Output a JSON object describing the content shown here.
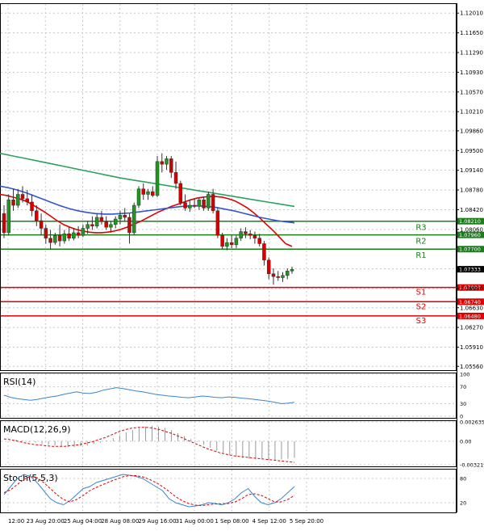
{
  "chart_data": {
    "type": "candlestick",
    "price_axis_ticks": [
      "1.12010",
      "1.11650",
      "1.11290",
      "1.10930",
      "1.10570",
      "1.10210",
      "1.09860",
      "1.09500",
      "1.09140",
      "1.08780",
      "1.08420",
      "1.08060",
      "1.07340",
      "1.06980",
      "1.06630",
      "1.06270",
      "1.05910",
      "1.05560"
    ],
    "price_range": [
      1.0549,
      1.1219
    ],
    "time_labels": [
      "12:00",
      "23 Aug 20:00",
      "25 Aug 04:00",
      "28 Aug 08:00",
      "29 Aug 16:00",
      "31 Aug 00:00",
      "1 Sep 08:00",
      "4 Sep 12:00",
      "5 Sep 20:00"
    ],
    "current_price": "1.07333",
    "levels": [
      {
        "label": "R3",
        "value": "1.08210",
        "price": 1.0821,
        "color": "#1a7f1a"
      },
      {
        "label": "R2",
        "value": "1.07960",
        "price": 1.0796,
        "color": "#1a7f1a"
      },
      {
        "label": "R1",
        "value": "1.07700",
        "price": 1.077,
        "color": "#1a7f1a"
      },
      {
        "label": "S1",
        "value": "1.07000",
        "price": 1.07,
        "color": "#e00000"
      },
      {
        "label": "S2",
        "value": "1.06740",
        "price": 1.0674,
        "color": "#e00000"
      },
      {
        "label": "S3",
        "value": "1.06480",
        "price": 1.0648,
        "color": "#e00000"
      }
    ],
    "candles": [
      [
        1.0835,
        1.085,
        1.079,
        1.08
      ],
      [
        1.08,
        1.087,
        1.0795,
        1.086
      ],
      [
        1.086,
        1.088,
        1.084,
        1.085
      ],
      [
        1.085,
        1.088,
        1.0845,
        1.087
      ],
      [
        1.087,
        1.0885,
        1.0855,
        1.0862
      ],
      [
        1.0862,
        1.0878,
        1.085,
        1.0856
      ],
      [
        1.0856,
        1.087,
        1.083,
        1.084
      ],
      [
        1.084,
        1.085,
        1.0812,
        1.0822
      ],
      [
        1.0822,
        1.0835,
        1.0795,
        1.0808
      ],
      [
        1.0808,
        1.0815,
        1.078,
        1.079
      ],
      [
        1.079,
        1.0805,
        1.077,
        1.0782
      ],
      [
        1.0782,
        1.08,
        1.0778,
        1.0795
      ],
      [
        1.0795,
        1.0815,
        1.0775,
        1.0785
      ],
      [
        1.0785,
        1.0805,
        1.078,
        1.0798
      ],
      [
        1.0798,
        1.081,
        1.0785,
        1.079
      ],
      [
        1.079,
        1.0808,
        1.0786,
        1.08
      ],
      [
        1.08,
        1.0812,
        1.079,
        1.0795
      ],
      [
        1.0795,
        1.0815,
        1.0792,
        1.0808
      ],
      [
        1.0808,
        1.082,
        1.0798,
        1.0815
      ],
      [
        1.0815,
        1.083,
        1.0805,
        1.0812
      ],
      [
        1.0812,
        1.0835,
        1.0808,
        1.0828
      ],
      [
        1.0828,
        1.084,
        1.0815,
        1.082
      ],
      [
        1.082,
        1.083,
        1.0805,
        1.081
      ],
      [
        1.081,
        1.082,
        1.08,
        1.0815
      ],
      [
        1.0815,
        1.083,
        1.0808,
        1.0825
      ],
      [
        1.0825,
        1.084,
        1.0815,
        1.0832
      ],
      [
        1.0832,
        1.0845,
        1.082,
        1.0828
      ],
      [
        1.0828,
        1.0835,
        1.078,
        1.08
      ],
      [
        1.08,
        1.0855,
        1.0795,
        1.085
      ],
      [
        1.085,
        1.0885,
        1.0845,
        1.088
      ],
      [
        1.088,
        1.089,
        1.086,
        1.087
      ],
      [
        1.087,
        1.088,
        1.086,
        1.0875
      ],
      [
        1.0875,
        1.0885,
        1.0865,
        1.0868
      ],
      [
        1.0868,
        1.094,
        1.0865,
        1.093
      ],
      [
        1.093,
        1.0945,
        1.091,
        1.0925
      ],
      [
        1.0925,
        1.094,
        1.0915,
        1.0935
      ],
      [
        1.0935,
        1.094,
        1.09,
        1.091
      ],
      [
        1.091,
        1.093,
        1.088,
        1.089
      ],
      [
        1.089,
        1.0895,
        1.085,
        1.0855
      ],
      [
        1.0855,
        1.087,
        1.084,
        1.0845
      ],
      [
        1.0845,
        1.086,
        1.0838,
        1.085
      ],
      [
        1.085,
        1.0862,
        1.0845,
        1.0848
      ],
      [
        1.0848,
        1.0865,
        1.0842,
        1.086
      ],
      [
        1.086,
        1.0865,
        1.084,
        1.0845
      ],
      [
        1.0845,
        1.0875,
        1.084,
        1.087
      ],
      [
        1.087,
        1.088,
        1.0835,
        1.084
      ],
      [
        1.084,
        1.0845,
        1.079,
        1.0795
      ],
      [
        1.0795,
        1.08,
        1.077,
        1.0775
      ],
      [
        1.0775,
        1.079,
        1.0768,
        1.0782
      ],
      [
        1.0782,
        1.0795,
        1.0772,
        1.0778
      ],
      [
        1.0778,
        1.0795,
        1.0772,
        1.079
      ],
      [
        1.079,
        1.0808,
        1.0785,
        1.0802
      ],
      [
        1.0802,
        1.081,
        1.079,
        1.0798
      ],
      [
        1.0798,
        1.0805,
        1.0788,
        1.0795
      ],
      [
        1.0795,
        1.0802,
        1.078,
        1.079
      ],
      [
        1.079,
        1.0798,
        1.0775,
        1.078
      ],
      [
        1.078,
        1.0785,
        1.074,
        1.075
      ],
      [
        1.075,
        1.0755,
        1.0715,
        1.0725
      ],
      [
        1.0725,
        1.0735,
        1.0705,
        1.072
      ],
      [
        1.072,
        1.073,
        1.0712,
        1.0718
      ],
      [
        1.0718,
        1.0728,
        1.071,
        1.0722
      ],
      [
        1.0722,
        1.0735,
        1.0715,
        1.073
      ],
      [
        1.073,
        1.0738,
        1.0725,
        1.0733
      ]
    ],
    "moving_averages": [
      {
        "color": "#e00000",
        "points": [
          1.087,
          1.0868,
          1.0865,
          1.0862,
          1.0858,
          1.0852,
          1.0845,
          1.0838,
          1.083,
          1.0822,
          1.0815,
          1.081,
          1.0806,
          1.0803,
          1.0801,
          1.08,
          1.08,
          1.0801,
          1.0803,
          1.0806,
          1.081,
          1.0815,
          1.082,
          1.0826,
          1.0832,
          1.0838,
          1.0843,
          1.0848,
          1.0852,
          1.0856,
          1.086,
          1.0863,
          1.0865,
          1.0866,
          1.0866,
          1.0865,
          1.0862,
          1.0858,
          1.0852,
          1.0845,
          1.0836,
          1.0826,
          1.0815,
          1.0804,
          1.0792,
          1.078,
          1.0775
        ]
      },
      {
        "color": "#3355cc",
        "points": [
          1.0885,
          1.0882,
          1.0878,
          1.0873,
          1.0867,
          1.0861,
          1.0855,
          1.0849,
          1.0844,
          1.084,
          1.0837,
          1.0835,
          1.0834,
          1.0834,
          1.0835,
          1.0836,
          1.0838,
          1.084,
          1.0842,
          1.0844,
          1.0846,
          1.0848,
          1.0849,
          1.0849,
          1.0848,
          1.0846,
          1.0843,
          1.084,
          1.0836,
          1.0832,
          1.0828,
          1.0825,
          1.0822,
          1.082,
          1.0818
        ]
      },
      {
        "color": "#2ca25f",
        "points": [
          1.0945,
          1.094,
          1.0935,
          1.093,
          1.0925,
          1.092,
          1.0915,
          1.091,
          1.0905,
          1.09,
          1.0896,
          1.0892,
          1.0888,
          1.0884,
          1.088,
          1.0876,
          1.0872,
          1.0868,
          1.0864,
          1.086,
          1.0856,
          1.0852,
          1.0848
        ]
      }
    ],
    "indicators": [
      {
        "label": "RSI(14)",
        "ticks": [
          "100",
          "70",
          "30",
          "0"
        ],
        "range": [
          0,
          100
        ],
        "series": [
          {
            "color": "#3a85d0",
            "dash": "",
            "values": [
              50,
              45,
              42,
              40,
              38,
              40,
              43,
              46,
              48,
              52,
              55,
              58,
              55,
              54,
              57,
              62,
              65,
              68,
              66,
              63,
              60,
              58,
              55,
              52,
              50,
              48,
              47,
              45,
              44,
              46,
              48,
              47,
              45,
              44,
              46,
              45,
              43,
              42,
              40,
              38,
              36,
              33,
              30,
              31,
              33
            ]
          }
        ]
      },
      {
        "label": "MACD(12,26,9)",
        "ticks": [
          "0.002635",
          "0.00",
          "-0.003219"
        ],
        "range": [
          -0.003219,
          0.002635
        ],
        "histogram": [
          0.0002,
          0.0001,
          -0.0001,
          -0.0002,
          -0.0004,
          -0.0005,
          -0.0006,
          -0.0007,
          -0.0008,
          -0.0008,
          -0.0007,
          -0.0006,
          -0.0004,
          -0.0002,
          0.0001,
          0.0004,
          0.0008,
          0.0012,
          0.0015,
          0.0018,
          0.002,
          0.0021,
          0.002,
          0.0018,
          0.0015,
          0.0011,
          0.0007,
          0.0003,
          -0.0001,
          -0.0005,
          -0.0009,
          -0.0013,
          -0.0016,
          -0.0019,
          -0.0021,
          -0.0023,
          -0.0024,
          -0.0025,
          -0.0025,
          -0.0026,
          -0.0026,
          -0.0025,
          -0.0024,
          -0.0023
        ],
        "series": [
          {
            "color": "#e00000",
            "dash": "3,2",
            "values": [
              0.0003,
              0.0002,
              0.0,
              -0.0002,
              -0.0004,
              -0.0005,
              -0.0006,
              -0.0007,
              -0.0007,
              -0.0007,
              -0.0006,
              -0.0005,
              -0.0003,
              -0.0001,
              0.0002,
              0.0005,
              0.0009,
              0.0013,
              0.0016,
              0.0018,
              0.0019,
              0.0019,
              0.0018,
              0.0016,
              0.0013,
              0.001,
              0.0006,
              0.0002,
              -0.0002,
              -0.0006,
              -0.001,
              -0.0013,
              -0.0016,
              -0.0018,
              -0.002,
              -0.0021,
              -0.0022,
              -0.0023,
              -0.0024,
              -0.0025,
              -0.0026,
              -0.0027,
              -0.0028,
              -0.0029
            ]
          }
        ]
      },
      {
        "label": "Stoch(5,5,3)",
        "ticks": [
          "80",
          "20"
        ],
        "range": [
          0,
          100
        ],
        "series": [
          {
            "color": "#3a85d0",
            "dash": "",
            "values": [
              40,
              60,
              80,
              90,
              85,
              70,
              50,
              30,
              20,
              15,
              25,
              40,
              55,
              60,
              70,
              75,
              80,
              85,
              90,
              88,
              85,
              80,
              70,
              60,
              50,
              30,
              20,
              15,
              10,
              12,
              15,
              20,
              18,
              15,
              20,
              30,
              45,
              55,
              35,
              20,
              15,
              20,
              30,
              45,
              60
            ]
          },
          {
            "color": "#e00000",
            "dash": "3,2",
            "values": [
              45,
              52,
              65,
              78,
              85,
              82,
              70,
              55,
              40,
              28,
              22,
              28,
              38,
              50,
              58,
              65,
              72,
              78,
              84,
              87,
              87,
              84,
              78,
              70,
              60,
              48,
              35,
              25,
              18,
              14,
              13,
              15,
              17,
              17,
              18,
              22,
              30,
              40,
              42,
              38,
              30,
              22,
              22,
              28,
              38
            ]
          }
        ]
      }
    ]
  }
}
